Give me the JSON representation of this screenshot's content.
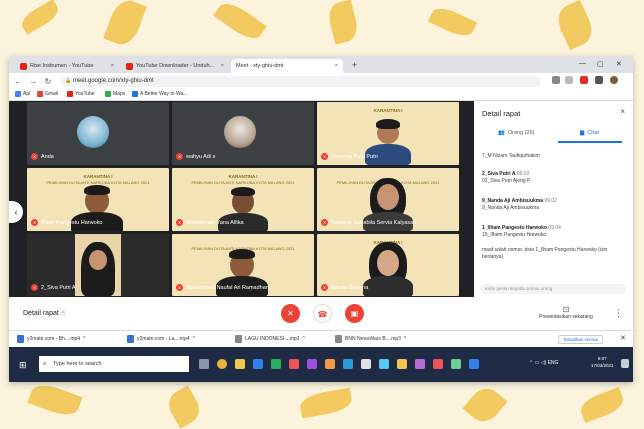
{
  "browser": {
    "tabs": [
      {
        "label": "Rise Instrumen - YouTube",
        "close": "×"
      },
      {
        "label": "YouTube Downloader - Unduh...",
        "close": "×"
      },
      {
        "label": "Meet - xty-ghiu-dmt",
        "close": "×"
      }
    ],
    "new_tab": "+",
    "window_controls": [
      "—",
      "▢",
      "✕"
    ],
    "url": "meet.google.com/xty-ghiu-dmt",
    "bookmarks": [
      "Apl",
      "Gmail",
      "YouTube",
      "Maps",
      "A Better Way to Wa..."
    ]
  },
  "meet": {
    "participants": [
      {
        "name": "Anda"
      },
      {
        "name": "wahyu Adi s"
      },
      {
        "name": "Vivienna Putri Putri"
      },
      {
        "name": "Ilham Pangestu Harwoko"
      },
      {
        "name": "Muhammad Yana Alfika"
      },
      {
        "name": "Natasya Salsabila Servia Kalyasari"
      },
      {
        "name": "2_Siva Putri A"
      },
      {
        "name": "Muhammad Naufal Ari Ramadhan"
      },
      {
        "name": "Nanda Syavina"
      }
    ],
    "banner_title": "KARANTINA I",
    "banner_subtitle": "PEMILIHAN DUTA ANTI NARKOBA KOTA MALANG 2021",
    "details_label": "Detail rapat",
    "present_label": "Presentasikan sekarang",
    "more_label": "⋮"
  },
  "panel": {
    "title": "Detail rapat",
    "close": "×",
    "tab_people": "Orang (26)",
    "tab_chat": "Chat",
    "messages": [
      {
        "sender": "",
        "time": "",
        "text": "7_M Nizam Taufiqurhakim"
      },
      {
        "sender": "2_Siva Putri A",
        "time": "09.02",
        "text": "02_Siva Putri Ajeng P"
      },
      {
        "sender": "9_Nanda Aji Ambisuukma",
        "time": "09.02",
        "text": "9_Nanda Aji Ambisuukma"
      },
      {
        "sender": "1_Ilham Pangestu Harwoko",
        "time": "09.04",
        "text": "15_Ilham Pangestu Harwoko"
      },
      {
        "sender": "",
        "time": "",
        "text": "maaf salah nomor, dsta 1_Ilham Pangestu Harwoko (izin bertanya)"
      }
    ],
    "send_placeholder": "Kirim pesan kepada semua orang"
  },
  "downloads": [
    {
      "label": "y2mate.com - Bh....mp4"
    },
    {
      "label": "y2mate.com - La....mp4"
    },
    {
      "label": "LAGU INDONESI....mp3"
    },
    {
      "label": "BNN NewsWars B....mp3"
    }
  ],
  "downloads_show_all": "Tampilkan semua",
  "taskbar": {
    "search_placeholder": "Type here to search",
    "language": "ENG",
    "time": "9:07",
    "date": "17/03/2021"
  },
  "colors": {
    "accent": "#1a73e8",
    "end_call": "#ea4335",
    "background": "#fbf3dc",
    "leaf": "#f0c24a"
  }
}
